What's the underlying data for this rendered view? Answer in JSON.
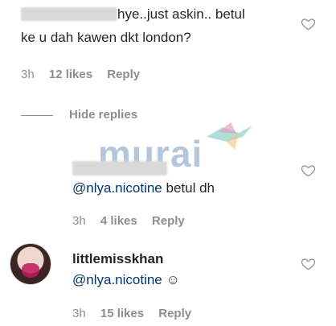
{
  "comments": {
    "first": {
      "line1": "hye..just askin.. betul",
      "line2": "ke u dah kawen dkt london?",
      "time": "3h",
      "likes": "12 likes",
      "reply": "Reply"
    },
    "hide_replies": "Hide replies",
    "reply1": {
      "mention": "@nlya.nicotine",
      "text": " betul dh",
      "time": "3h",
      "likes": "4 likes",
      "reply": "Reply"
    },
    "reply2": {
      "username": "littlemisskhan",
      "mention": "@nlya.nicotine",
      "text": " ☺",
      "time": "3h",
      "likes": "15 likes",
      "reply": "Reply"
    }
  },
  "watermark": {
    "text": "murai"
  },
  "colors": {
    "heart_stroke": "#8e8e8e",
    "link": "#003569",
    "meta": "#8e8e8e"
  }
}
